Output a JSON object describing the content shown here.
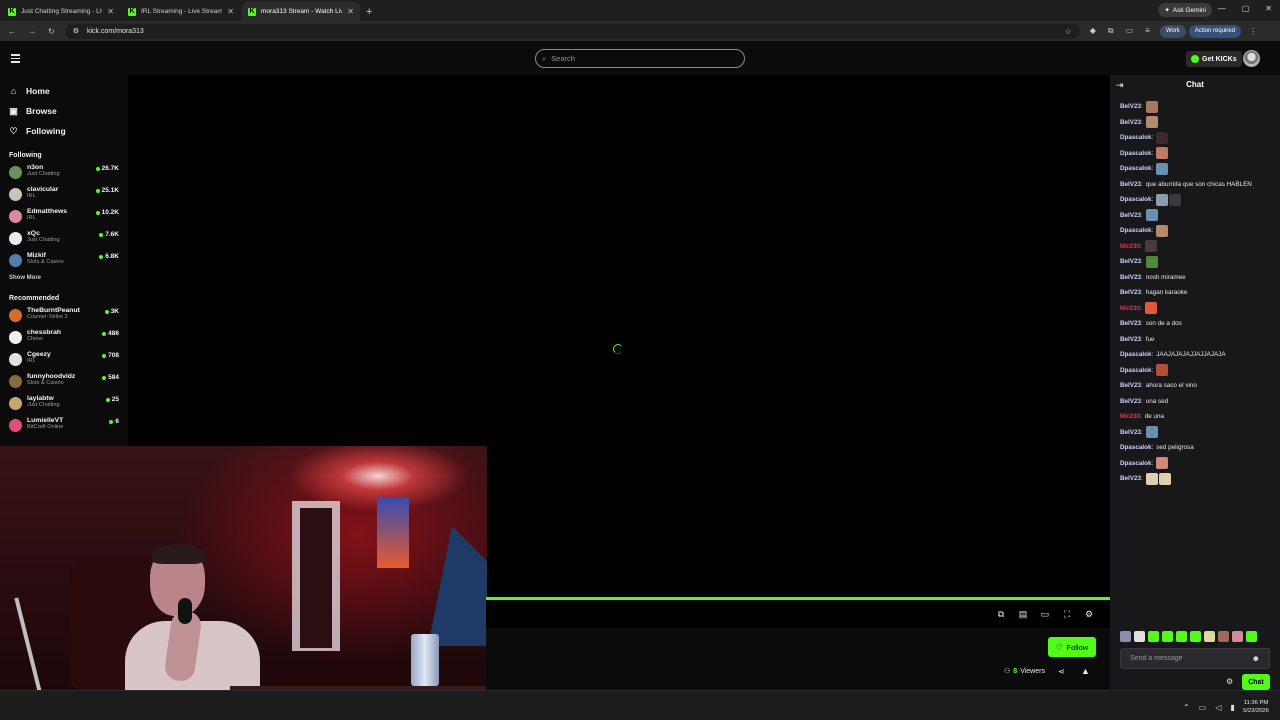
{
  "browser": {
    "tabs": [
      {
        "title": "Just Chatting Streaming - Live S",
        "active": false
      },
      {
        "title": "IRL Streaming - Live Streams on",
        "active": false
      },
      {
        "title": "mora313 Stream - Watch Live o",
        "active": true
      }
    ],
    "new_tab": "+",
    "ask_gemini": "Ask Gemini",
    "url": "kick.com/mora313",
    "profile_label": "Work",
    "action_label": "Action required"
  },
  "topbar": {
    "search_placeholder": "Search",
    "get_kicks": "Get KICKs"
  },
  "sidebar": {
    "nav": [
      {
        "label": "Home",
        "icon": "home-icon"
      },
      {
        "label": "Browse",
        "icon": "compass-icon"
      },
      {
        "label": "Following",
        "icon": "heart-icon"
      }
    ],
    "following_title": "Following",
    "following": [
      {
        "name": "n3on",
        "category": "Just Chatting",
        "viewers": "26.7K",
        "color": "#6f8f5a"
      },
      {
        "name": "clavicular",
        "category": "IRL",
        "viewers": "25.1K",
        "color": "#c9c3b8"
      },
      {
        "name": "Edmatthews",
        "category": "IRL",
        "viewers": "10.2K",
        "color": "#d98aa0"
      },
      {
        "name": "xQc",
        "category": "Just Chatting",
        "viewers": "7.6K",
        "color": "#e9e9e9"
      },
      {
        "name": "Mizkif",
        "category": "Slots & Casino",
        "viewers": "6.8K",
        "color": "#4f7fb0"
      }
    ],
    "show_more": "Show More",
    "recommended_title": "Recommended",
    "recommended": [
      {
        "name": "TheBurntPeanut",
        "category": "Counter-Strike 2",
        "viewers": "3K",
        "color": "#d86a2c"
      },
      {
        "name": "chessbrah",
        "category": "Chess",
        "viewers": "486",
        "color": "#f0f0f0"
      },
      {
        "name": "Cgeezy",
        "category": "IRL",
        "viewers": "708",
        "color": "#e0e0e0"
      },
      {
        "name": "funnyhoodvidz",
        "category": "Slots & Casino",
        "viewers": "584",
        "color": "#8a6a3a"
      },
      {
        "name": "laylabtw",
        "category": "Just Chatting",
        "viewers": "25",
        "color": "#c9a66b"
      },
      {
        "name": "LumielleVT",
        "category": "BitCraft Online",
        "viewers": "6",
        "color": "#e04f7a"
      }
    ]
  },
  "stream": {
    "follow_label": "Follow",
    "viewers_count": "8",
    "viewers_label": "Viewers",
    "accent": "#53fc18"
  },
  "chat": {
    "title": "Chat",
    "messages": [
      {
        "user": "BelV23",
        "text": "",
        "color": "#c8d3ff",
        "emotes": [
          "#a8785e"
        ]
      },
      {
        "user": "BelV23",
        "text": "",
        "color": "#c8d3ff",
        "emotes": [
          "#b68a6e"
        ]
      },
      {
        "user": "Dpascalok",
        "text": "",
        "color": "#c8d3ff",
        "emotes": [
          "#3a2a2a"
        ]
      },
      {
        "user": "Dpascalok",
        "text": "",
        "color": "#c8d3ff",
        "emotes": [
          "#c07a6a"
        ]
      },
      {
        "user": "Dpascalok",
        "text": "",
        "color": "#c8d3ff",
        "emotes": [
          "#6a8fb0"
        ]
      },
      {
        "user": "BelV23",
        "text": "que aburrida que son chicas HABLEN",
        "color": "#c8d3ff",
        "emotes": []
      },
      {
        "user": "Dpascalok",
        "text": "",
        "color": "#c8d3ff",
        "emotes": [
          "#8a9bb0",
          "#3a3a3a"
        ]
      },
      {
        "user": "BelV23",
        "text": "",
        "color": "#c8d3ff",
        "emotes": [
          "#6a8fb0"
        ]
      },
      {
        "user": "Dpascalok",
        "text": "",
        "color": "#c8d3ff",
        "emotes": [
          "#b68a6e"
        ]
      },
      {
        "user": "Mir230",
        "text": "",
        "color": "#e0325a",
        "emotes": [
          "#4a3a3a"
        ]
      },
      {
        "user": "BelV23",
        "text": "",
        "color": "#c8d3ff",
        "emotes": [
          "#4f8a3a"
        ]
      },
      {
        "user": "BelV23",
        "text": "nosh miramee",
        "color": "#c8d3ff",
        "emotes": []
      },
      {
        "user": "BelV23",
        "text": "hagan karaoke",
        "color": "#c8d3ff",
        "emotes": []
      },
      {
        "user": "Mir230",
        "text": "",
        "color": "#e0325a",
        "emotes": [
          "#e05a3a"
        ]
      },
      {
        "user": "BelV23",
        "text": "son de a dos",
        "color": "#c8d3ff",
        "emotes": []
      },
      {
        "user": "BelV23",
        "text": "fue",
        "color": "#c8d3ff",
        "emotes": []
      },
      {
        "user": "Dpascalok",
        "text": "JAAJAJAJAJJAJJAJAJA",
        "color": "#c8d3ff",
        "emotes": []
      },
      {
        "user": "Dpascalok",
        "text": "",
        "color": "#c8d3ff",
        "emotes": [
          "#b0503a"
        ]
      },
      {
        "user": "BelV23",
        "text": "ahora saco el vino",
        "color": "#c8d3ff",
        "emotes": []
      },
      {
        "user": "BelV23",
        "text": "una sed",
        "color": "#c8d3ff",
        "emotes": []
      },
      {
        "user": "Mir230",
        "text": "de una",
        "color": "#e0325a",
        "emotes": []
      },
      {
        "user": "BelV23",
        "text": "",
        "color": "#c8d3ff",
        "emotes": [
          "#6a8fb0"
        ]
      },
      {
        "user": "Dpascalok",
        "text": "sed peligrosa",
        "color": "#c8d3ff",
        "emotes": []
      },
      {
        "user": "Dpascalok",
        "text": "",
        "color": "#c8d3ff",
        "emotes": [
          "#d08a7a"
        ]
      },
      {
        "user": "BelV23",
        "text": "",
        "color": "#c8d3ff",
        "emotes": [
          "#e0d0b0",
          "#e0d0b0"
        ]
      }
    ],
    "emote_bar": [
      "#8a8fb0",
      "#e0e0e0",
      "#53fc18",
      "#53fc18",
      "#53fc18",
      "#53fc18",
      "#e0d8a0",
      "#a06a5a",
      "#d08a9a",
      "#53fc18"
    ],
    "input_placeholder": "Send a message",
    "send_label": "Chat"
  },
  "taskbar": {
    "time": "11:36 PM",
    "date": "5/23/2026"
  }
}
